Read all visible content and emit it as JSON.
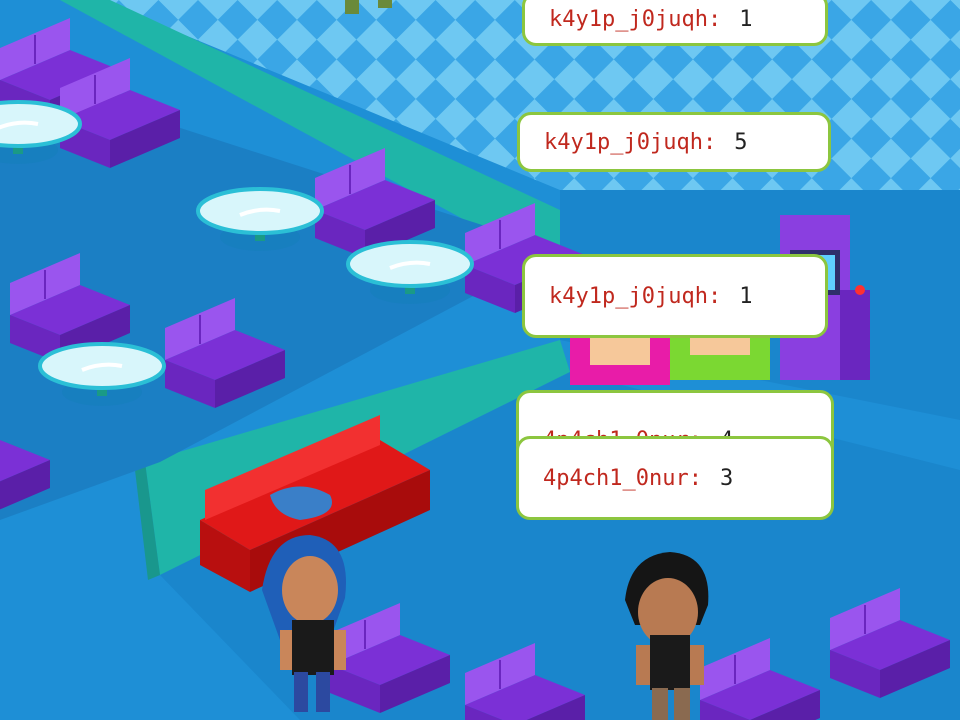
{
  "chat": [
    {
      "user": "k4y1p_j0juqh:",
      "message": "1"
    },
    {
      "user": "k4y1p_j0juqh:",
      "message": "5"
    },
    {
      "user": "k4y1p_j0juqh:",
      "message": "1"
    },
    {
      "user": "4p4ch1_0nur:",
      "message": "4"
    },
    {
      "user": "4p4ch1_0nur:",
      "message": "3"
    }
  ],
  "colors": {
    "floor": "#1e8fd6",
    "checker_light": "#6ec8f2",
    "checker_dark": "#3aa6e6",
    "teal_wall": "#1fb5a8",
    "sofa_purple": "#8a3fe0",
    "sofa_red": "#e01818",
    "table_top": "#bff0f8",
    "bubble_border": "#8cc63f",
    "username": "#c0281e"
  },
  "icons": {
    "arcade": "arcade-machine-icon",
    "avatar_blue": "avatar-blue-hair-icon",
    "avatar_black": "avatar-black-hair-icon"
  }
}
